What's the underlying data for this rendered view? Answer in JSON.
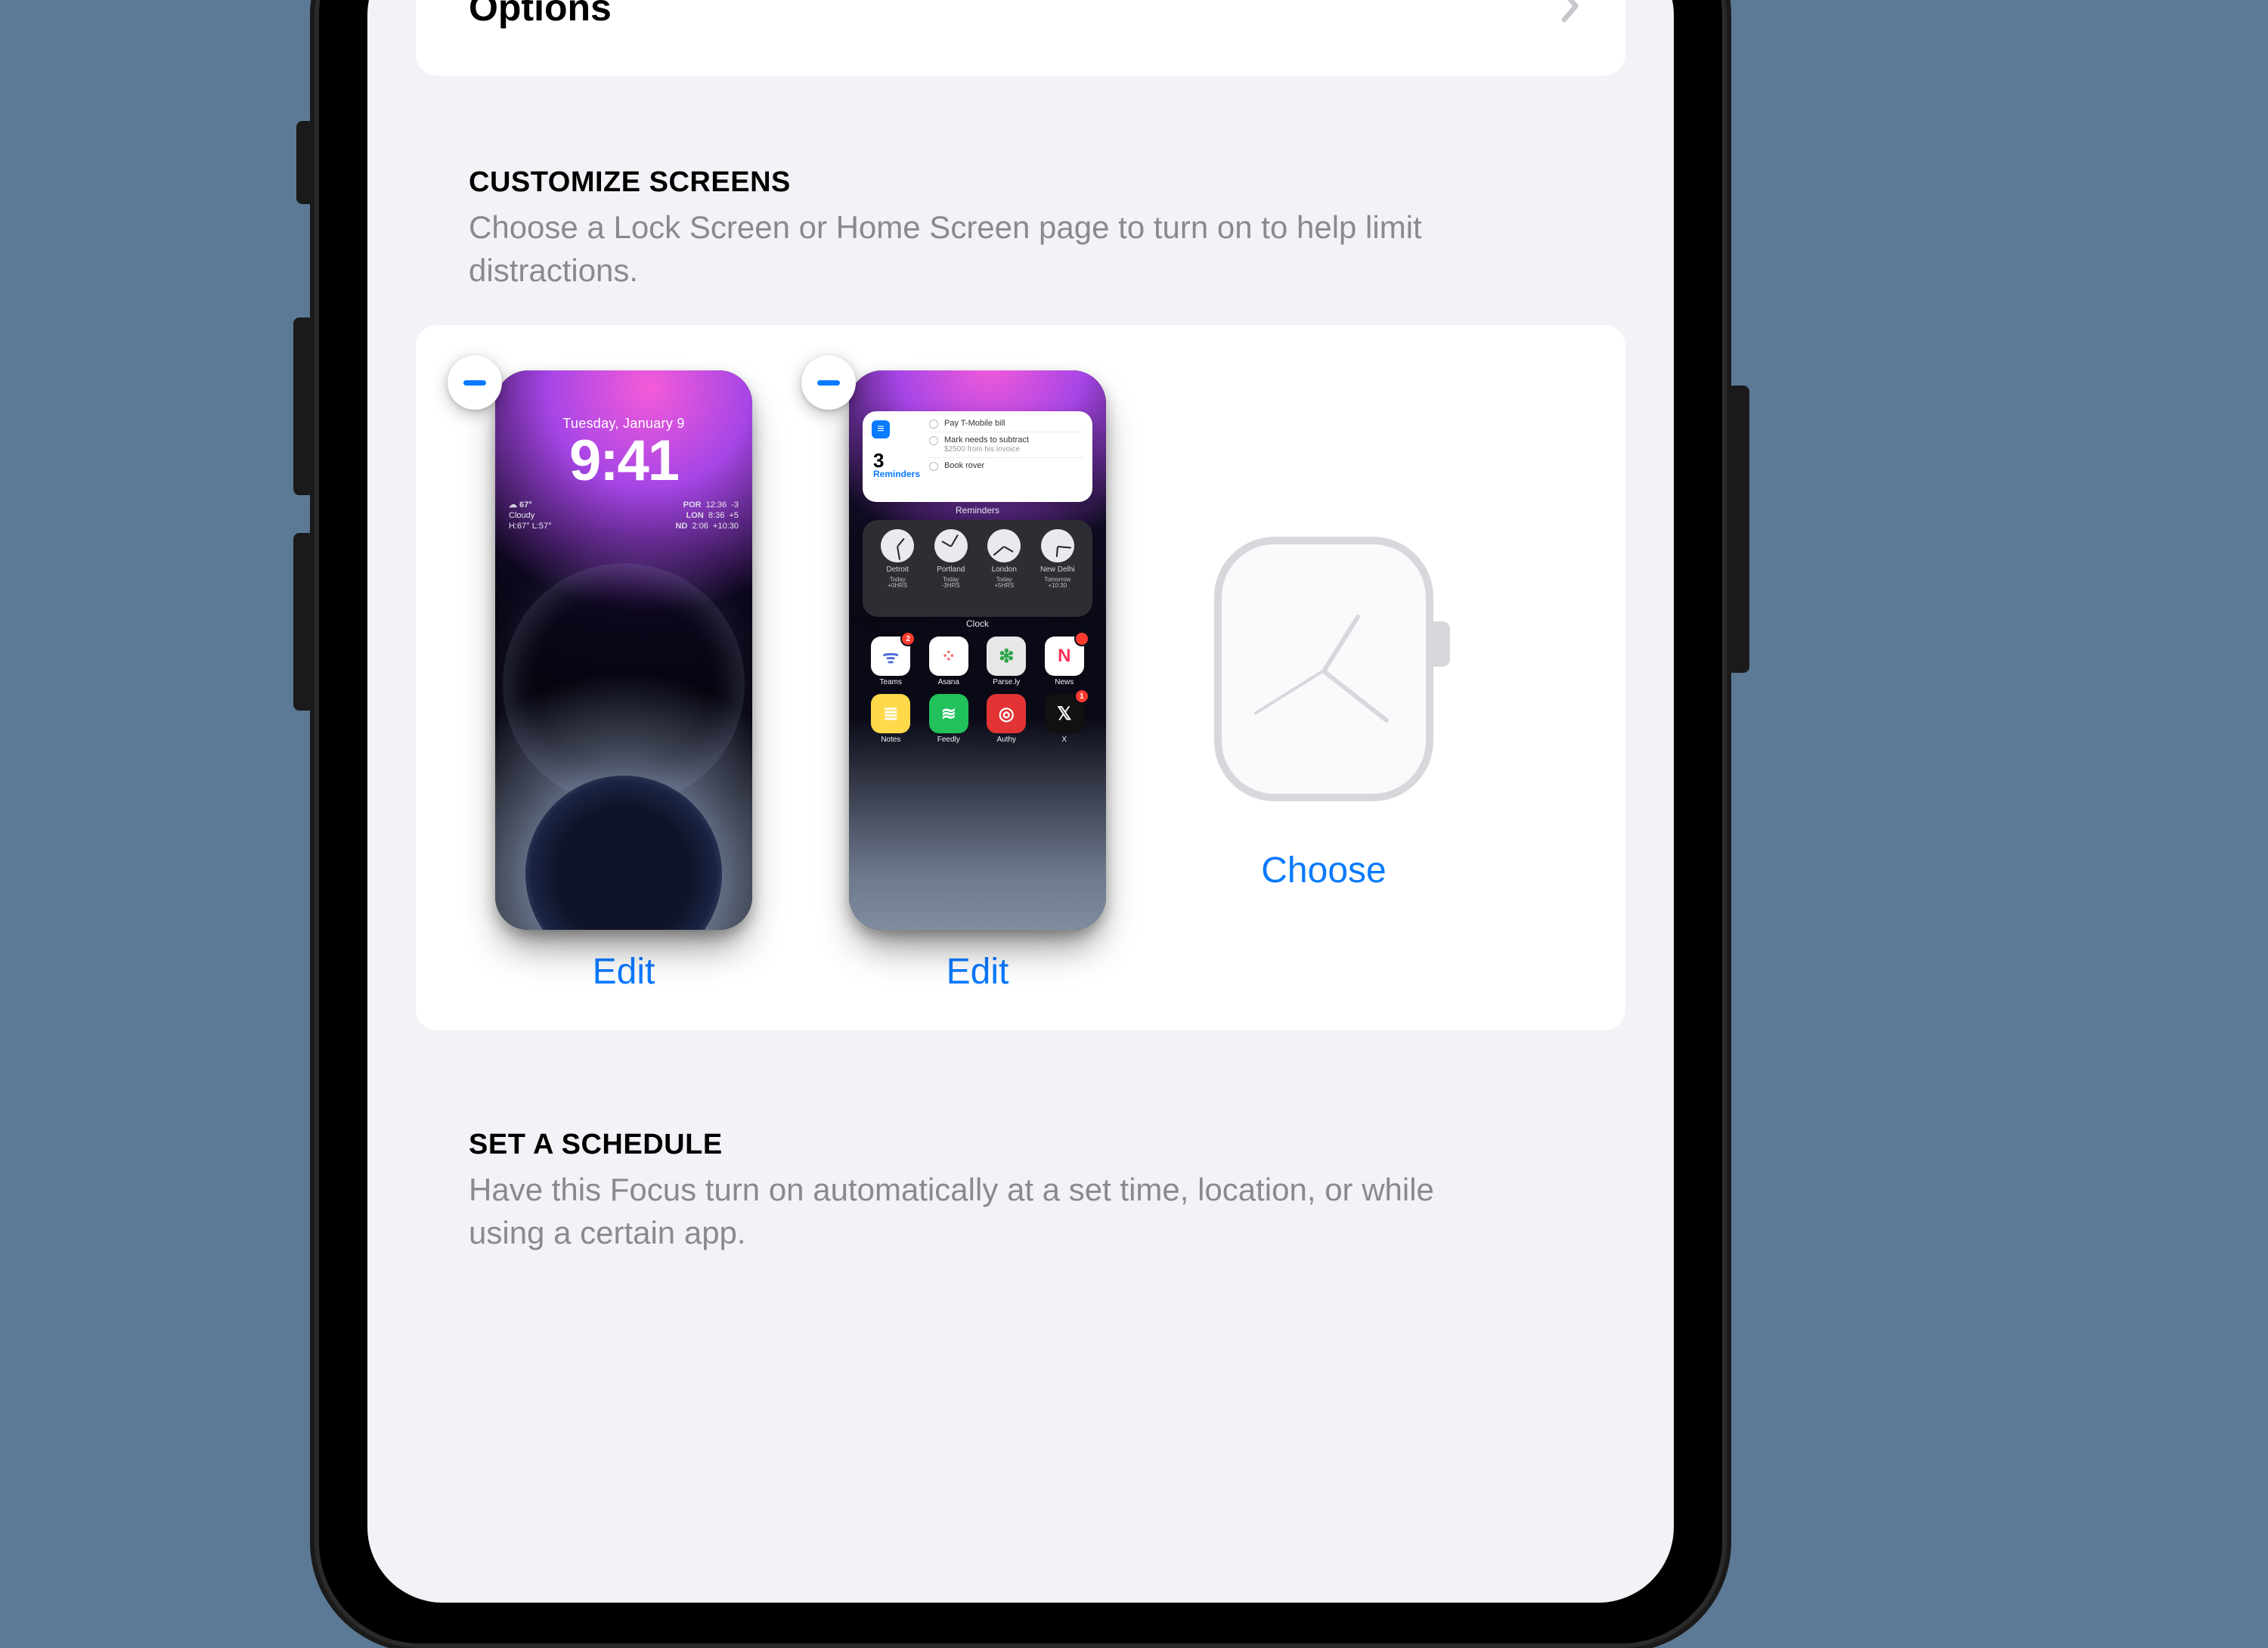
{
  "options_row": {
    "label": "Options"
  },
  "customize": {
    "title": "CUSTOMIZE SCREENS",
    "subtitle": "Choose a Lock Screen or Home Screen page to turn on to help limit distractions.",
    "lock": {
      "action": "Edit",
      "date": "Tuesday, January 9",
      "time": "9:41",
      "left": {
        "line1": "☁︎ 67°",
        "line2": "Cloudy",
        "line3": "H:67° L:57°"
      },
      "right_rows": [
        {
          "city": "POR",
          "time": "12:36",
          "offset": "-3"
        },
        {
          "city": "LON",
          "time": "8:36",
          "offset": "+5"
        },
        {
          "city": "ND",
          "time": "2:06",
          "offset": "+10:30"
        }
      ]
    },
    "home": {
      "action": "Edit",
      "reminders": {
        "count": "3",
        "label": "Reminders",
        "caption": "Reminders",
        "items": [
          {
            "title": "Pay T-Mobile bill"
          },
          {
            "title": "Mark needs to subtract",
            "sub": "$2500 from his invoice"
          },
          {
            "title": "Book rover"
          }
        ]
      },
      "clocks": {
        "caption": "Clock",
        "cities": [
          {
            "name": "Detroit",
            "sub1": "Today",
            "sub2": "+0HRS"
          },
          {
            "name": "Portland",
            "sub1": "Today",
            "sub2": "-3HRS"
          },
          {
            "name": "London",
            "sub1": "Today",
            "sub2": "+5HRS"
          },
          {
            "name": "New Delhi",
            "sub1": "Tomorrow",
            "sub2": "+10:30"
          }
        ]
      },
      "apps_row1": [
        {
          "name": "Teams",
          "glyph": "ᯤ",
          "cls": "bg-white",
          "badge": "2"
        },
        {
          "name": "Asana",
          "glyph": "⁘",
          "cls": "bg-white",
          "glyph_color": "#f06a6a"
        },
        {
          "name": "Parse.ly",
          "glyph": "❇︎",
          "cls": "bg-grey",
          "glyph_color": "#2aa54a"
        },
        {
          "name": "News",
          "glyph": "N",
          "cls": "bg-white",
          "glyph_color": "#ff2d55",
          "badge": ""
        }
      ],
      "apps_row2": [
        {
          "name": "Notes",
          "glyph": "≣",
          "cls": "bg-yellow"
        },
        {
          "name": "Feedly",
          "glyph": "≋",
          "cls": "bg-green"
        },
        {
          "name": "Authy",
          "glyph": "◎",
          "cls": "bg-red"
        },
        {
          "name": "X",
          "glyph": "𝕏",
          "cls": "bg-dark",
          "badge": "1"
        }
      ]
    },
    "watch": {
      "action": "Choose"
    }
  },
  "schedule": {
    "title": "SET A SCHEDULE",
    "subtitle": "Have this Focus turn on automatically at a set time, location, or while using a certain app."
  },
  "colors": {
    "link": "#0a7aff"
  }
}
